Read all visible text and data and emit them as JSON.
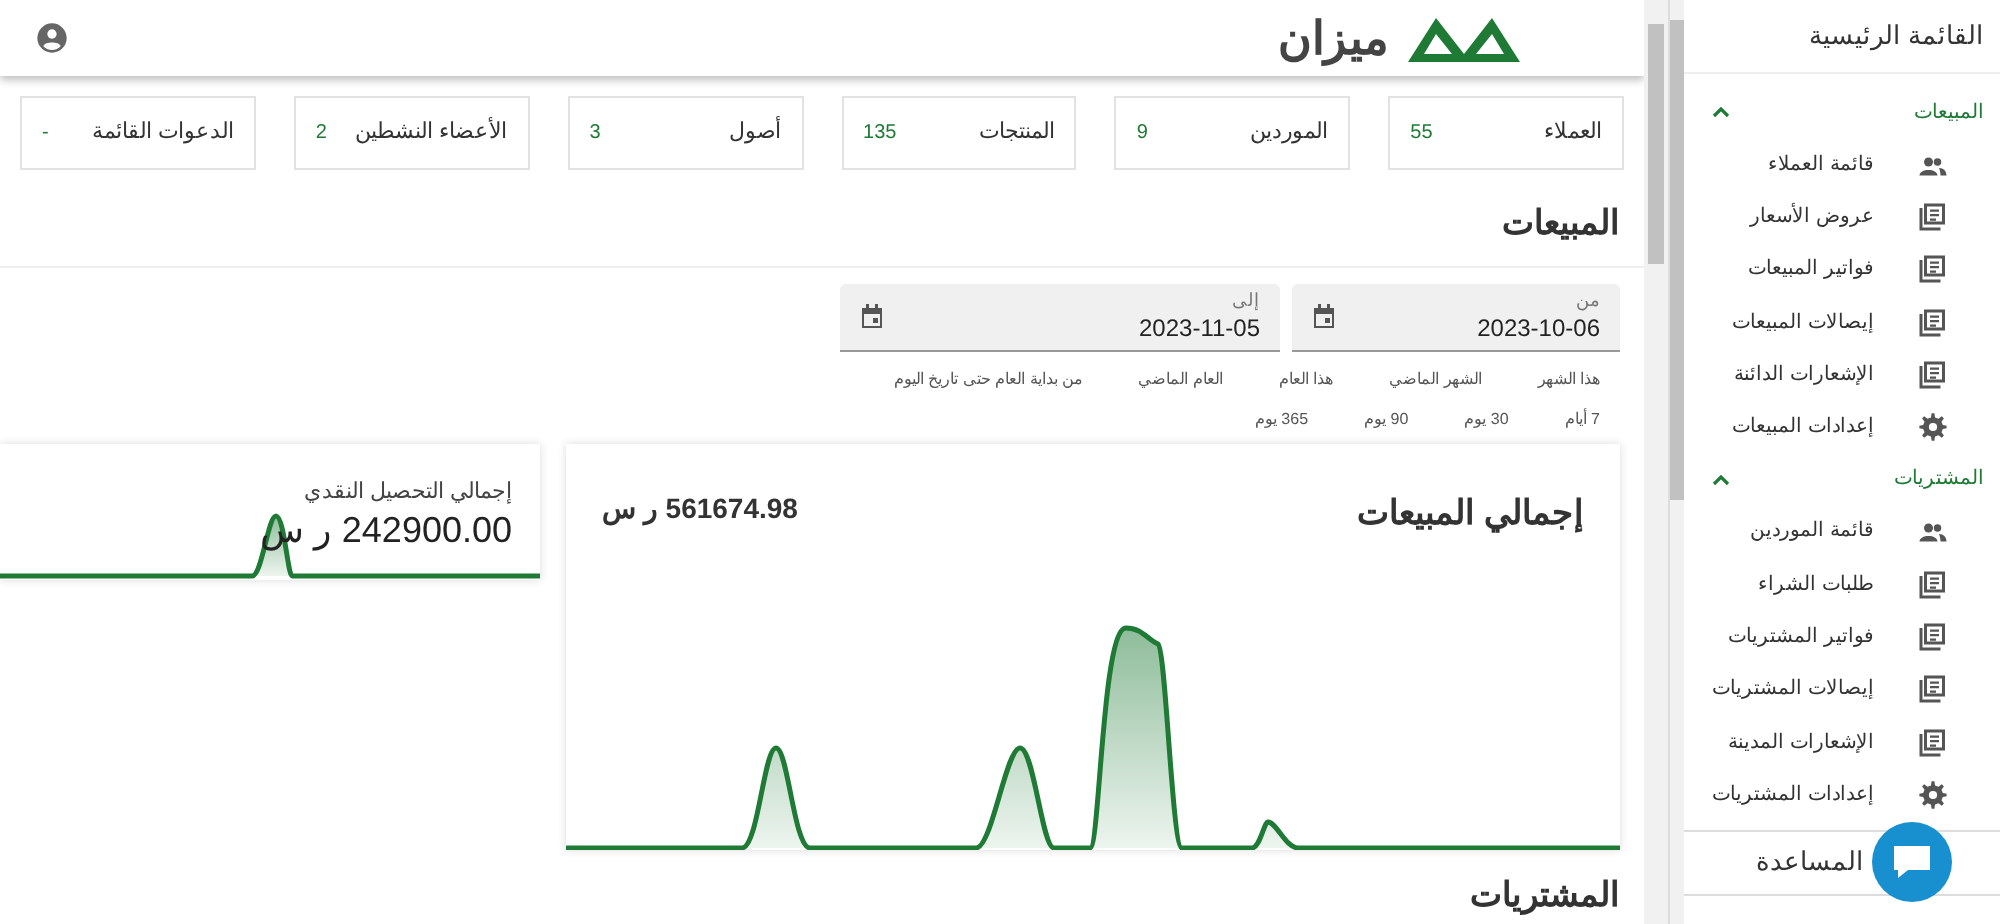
{
  "header": {
    "logo_text": "ميزان"
  },
  "stats": [
    {
      "label": "العملاء",
      "value": "55"
    },
    {
      "label": "الموردين",
      "value": "9"
    },
    {
      "label": "المنتجات",
      "value": "135"
    },
    {
      "label": "أصول",
      "value": "3"
    },
    {
      "label": "الأعضاء النشطين",
      "value": "2"
    },
    {
      "label": "الدعوات القائمة",
      "value": "-"
    }
  ],
  "sales_section": {
    "title": "المبيعات",
    "date_from": {
      "label": "من",
      "value": "2023-10-06"
    },
    "date_to": {
      "label": "إلى",
      "value": "2023-11-05"
    },
    "quick_ranges": [
      [
        "هذا الشهر",
        "الشهر الماضي",
        "هذا العام",
        "العام الماضي",
        "من بداية العام حتى تاريخ اليوم"
      ],
      [
        "7 أيام",
        "30 يوم",
        "90 يوم",
        "365 يوم"
      ]
    ],
    "total_sales": {
      "title": "إجمالي المبيعات",
      "value": "561674.98 ر س"
    },
    "cash_collection": {
      "title": "إجمالي التحصيل النقدي",
      "value": "242900.00 ر س"
    }
  },
  "purchases_section": {
    "title": "المشتريات"
  },
  "sidebar": {
    "title": "القائمة الرئيسية",
    "groups": [
      {
        "label": "المبيعات",
        "expanded": true,
        "items": [
          {
            "label": "قائمة العملاء",
            "kind": "people"
          },
          {
            "label": "عروض الأسعار",
            "kind": "list"
          },
          {
            "label": "فواتير المبيعات",
            "kind": "list"
          },
          {
            "label": "إيصالات المبيعات",
            "kind": "list"
          },
          {
            "label": "الإشعارات الدائنة",
            "kind": "list"
          },
          {
            "label": "إعدادات المبيعات",
            "kind": "gear"
          }
        ]
      },
      {
        "label": "المشتريات",
        "expanded": true,
        "items": [
          {
            "label": "قائمة الموردين",
            "kind": "people"
          },
          {
            "label": "طلبات الشراء",
            "kind": "list"
          },
          {
            "label": "فواتير المشتريات",
            "kind": "list"
          },
          {
            "label": "إيصالات المشتريات",
            "kind": "list"
          },
          {
            "label": "الإشعارات المدينة",
            "kind": "list"
          },
          {
            "label": "إعدادات المشتريات",
            "kind": "gear"
          }
        ]
      }
    ],
    "help": "المساعدة"
  }
}
